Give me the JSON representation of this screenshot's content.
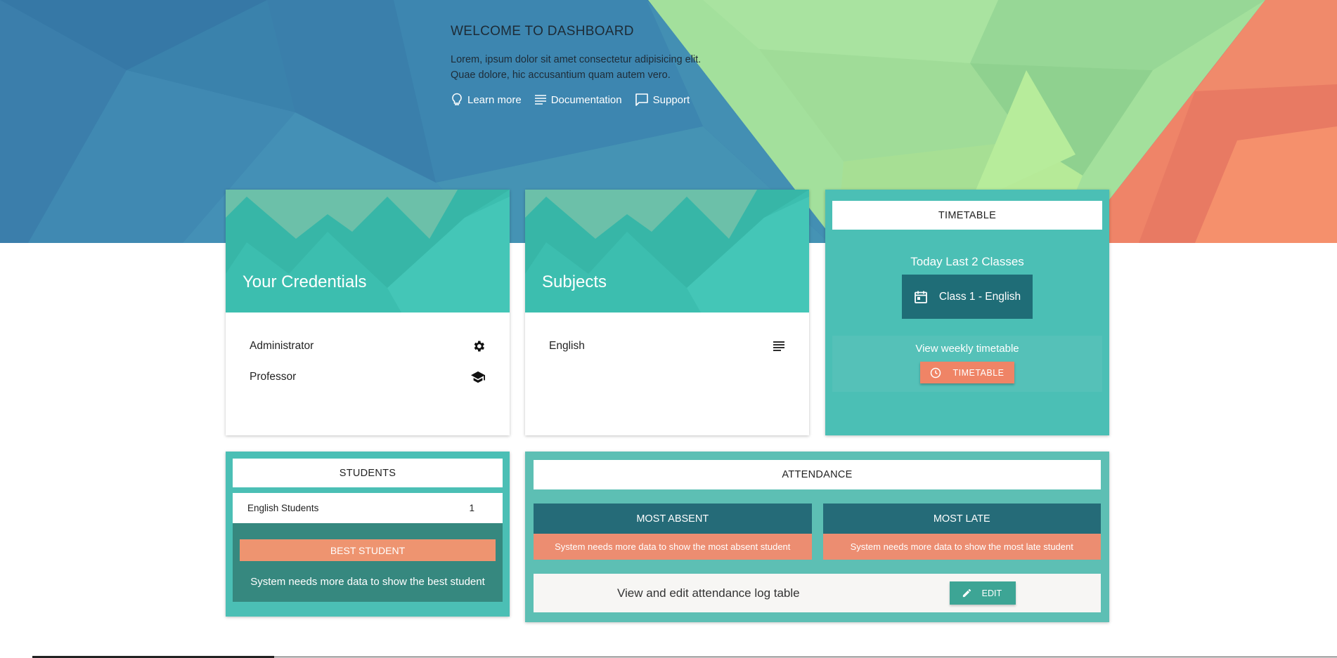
{
  "hero": {
    "title": "WELCOME TO DASHBOARD",
    "desc_line1": "Lorem, ipsum dolor sit amet consectetur adipisicing elit.",
    "desc_line2": "Quae dolore, hic accusantium quam autem vero.",
    "links": [
      {
        "label": "Learn more",
        "icon": "lightbulb-icon"
      },
      {
        "label": "Documentation",
        "icon": "notes-icon"
      },
      {
        "label": "Support",
        "icon": "chat-bubble-icon"
      }
    ]
  },
  "credentials": {
    "title": "Your Credentials",
    "items": [
      {
        "label": "Administrator",
        "icon": "gear-icon"
      },
      {
        "label": "Professor",
        "icon": "graduation-cap-icon"
      }
    ]
  },
  "subjects": {
    "title": "Subjects",
    "items": [
      {
        "label": "English",
        "icon": "notes-icon"
      }
    ]
  },
  "timetable": {
    "header": "TIMETABLE",
    "subtitle": "Today Last 2 Classes",
    "class_label": "Class 1 - English",
    "weekly_label": "View weekly timetable",
    "button_label": "TIMETABLE"
  },
  "students": {
    "header": "STUDENTS",
    "row_label": "English Students",
    "row_count": "1",
    "best_header": "BEST STUDENT",
    "best_text": "System needs more data to show the best student"
  },
  "attendance": {
    "header": "ATTENDANCE",
    "most_absent_header": "MOST ABSENT",
    "most_absent_text": "System needs more data to show the most absent student",
    "most_late_header": "MOST LATE",
    "most_late_text": "System needs more data to show the most late student",
    "log_text": "View and edit attendance log table",
    "edit_label": "EDIT"
  },
  "colors": {
    "teal": "#4bbfb5",
    "dark_teal": "#1f6d77",
    "salmon": "#ef8466",
    "hero_blue": "#3a83ad",
    "hero_green": "#9fdf9c",
    "hero_coral": "#ef8468"
  }
}
